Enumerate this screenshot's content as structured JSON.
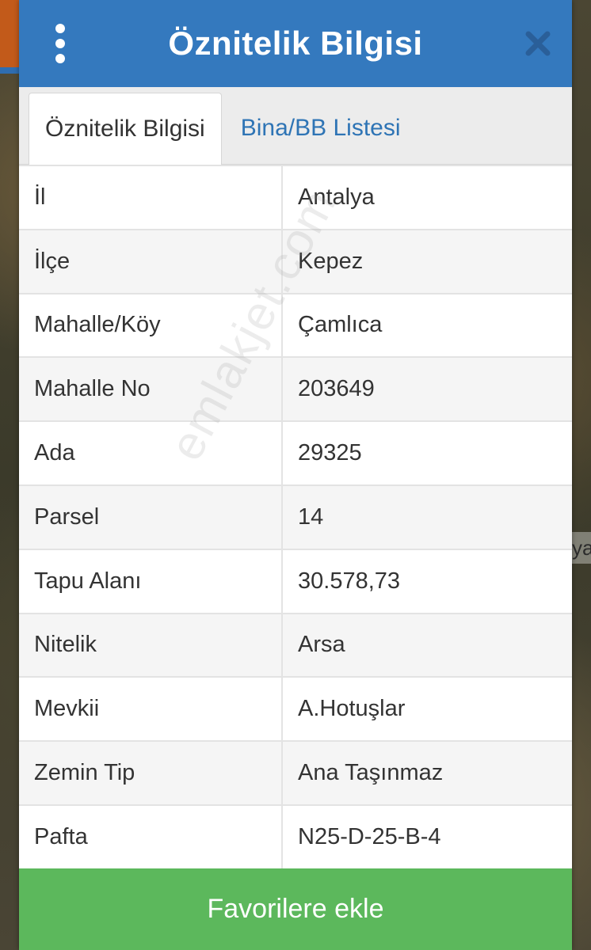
{
  "header": {
    "title": "Öznitelik Bilgisi"
  },
  "tabs": [
    {
      "label": "Öznitelik Bilgisi",
      "active": true
    },
    {
      "label": "Bina/BB Listesi",
      "active": false
    }
  ],
  "attributes": [
    {
      "key": "İl",
      "value": "Antalya"
    },
    {
      "key": "İlçe",
      "value": "Kepez"
    },
    {
      "key": "Mahalle/Köy",
      "value": "Çamlıca"
    },
    {
      "key": "Mahalle No",
      "value": "203649"
    },
    {
      "key": "Ada",
      "value": "29325"
    },
    {
      "key": "Parsel",
      "value": "14"
    },
    {
      "key": "Tapu Alanı",
      "value": "30.578,73"
    },
    {
      "key": "Nitelik",
      "value": "Arsa"
    },
    {
      "key": "Mevkii",
      "value": "A.Hotuşlar"
    },
    {
      "key": "Zemin Tip",
      "value": "Ana Taşınmaz"
    },
    {
      "key": "Pafta",
      "value": "N25-D-25-B-4"
    }
  ],
  "footer": {
    "button_label": "Favorilere ekle"
  },
  "watermark": "emlakjet.com",
  "map_label": "ya",
  "icons": {
    "menu": "more-vertical-icon",
    "close": "close-icon"
  },
  "colors": {
    "header": "#3479be",
    "tab_link": "#2e74b5",
    "button": "#5cb85c"
  }
}
